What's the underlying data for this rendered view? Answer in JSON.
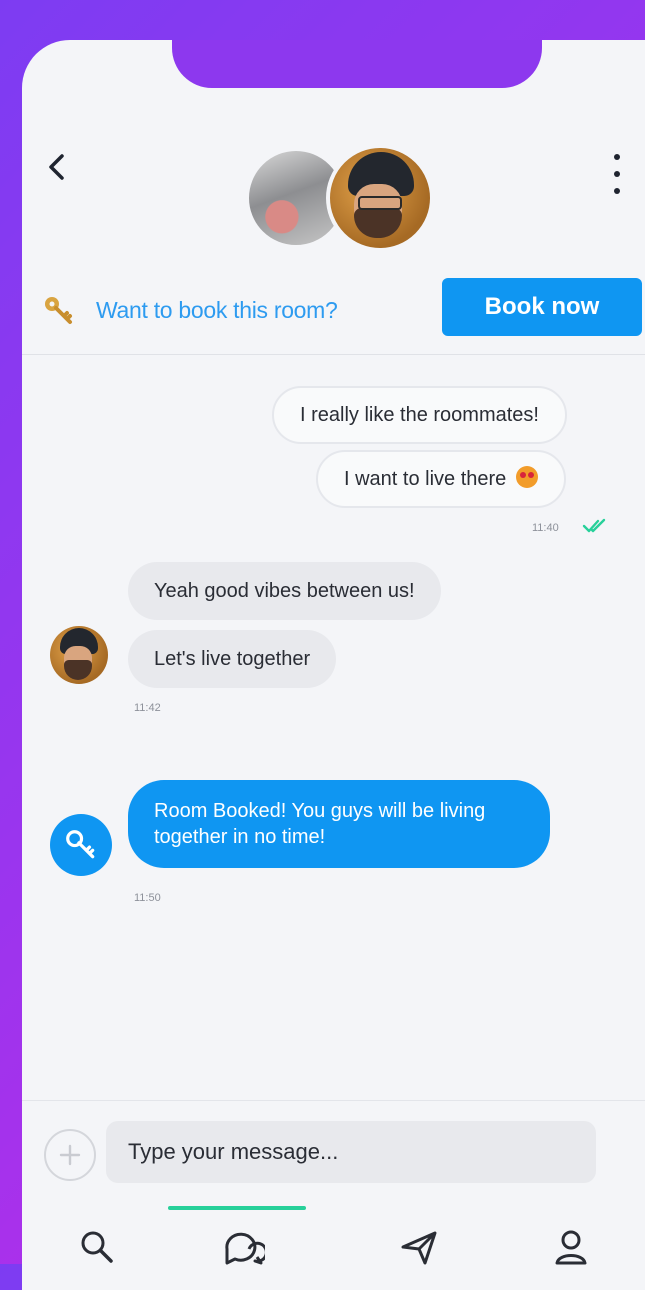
{
  "header": {
    "back_icon": "chevron-left-icon",
    "more_icon": "vertical-dots-icon",
    "avatars": [
      "room-photo",
      "user-photo"
    ]
  },
  "booking": {
    "icon": "key-icon",
    "prompt": "Want to book this room?",
    "button_label": "Book now",
    "button_color": "#0f96f2"
  },
  "messages": {
    "outgoing": [
      {
        "text": "I really like the roommates!"
      },
      {
        "text": "I want to live there",
        "emoji": "heart-eyes-emoji"
      }
    ],
    "outgoing_time": "11:40",
    "outgoing_status_icon": "double-check-icon",
    "incoming": [
      {
        "text": "Yeah good vibes between us!"
      },
      {
        "text": "Let's live together"
      }
    ],
    "incoming_time": "11:42",
    "system": {
      "text": "Room Booked! You guys will be living together in no time!",
      "time": "11:50",
      "icon": "key-icon"
    }
  },
  "composer": {
    "placeholder": "Type your message...",
    "plus_icon": "plus-icon"
  },
  "tabbar": {
    "tabs": [
      "search-icon",
      "chat-icon",
      "send-icon",
      "profile-icon"
    ],
    "active_tab": "chat-icon",
    "accent": "#27d09a"
  }
}
